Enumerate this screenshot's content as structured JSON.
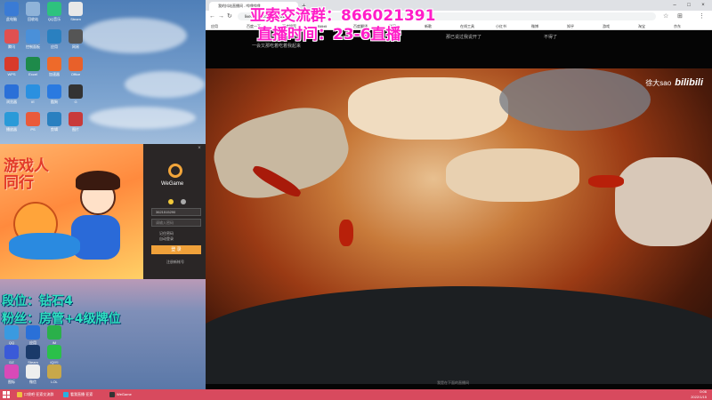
{
  "desktop": {
    "icons": [
      {
        "label": "此电脑",
        "color": "#3a7bd5"
      },
      {
        "label": "回收站",
        "color": "#8fb3d9"
      },
      {
        "label": "QQ音乐",
        "color": "#2ec27e"
      },
      {
        "label": "Steam",
        "color": "#e8e8e8"
      },
      {
        "label": "腾讯",
        "color": "#e05050"
      },
      {
        "label": "控制面板",
        "color": "#4a90d9"
      },
      {
        "label": "应用",
        "color": "#2a80c0"
      },
      {
        "label": "网易",
        "color": "#555"
      },
      {
        "label": "WPS",
        "color": "#d83a2a"
      },
      {
        "label": "Excel",
        "color": "#1e8a4a"
      },
      {
        "label": "加速器",
        "color": "#ee6a2a"
      },
      {
        "label": "Office",
        "color": "#e8602a"
      },
      {
        "label": "浏览器",
        "color": "#2a70d8"
      },
      {
        "label": "IE",
        "color": "#2a90e0"
      },
      {
        "label": "酷狗",
        "color": "#2a7ae0"
      },
      {
        "label": "G",
        "color": "#333"
      },
      {
        "label": "播放器",
        "color": "#2a9ad8"
      },
      {
        "label": "PS",
        "color": "#ea5a3a"
      },
      {
        "label": "剪辑",
        "color": "#2a80c0"
      },
      {
        "label": "图片",
        "color": "#c83a3a"
      }
    ],
    "overlay_line1": "段位：钻石4",
    "overlay_line2": "粉丝：房管+4级牌位",
    "bottom_icons": [
      {
        "label": "QQ",
        "color": "#3a9ae0"
      },
      {
        "label": "应用",
        "color": "#2a70d8"
      },
      {
        "label": "iM",
        "color": "#2ab04a"
      },
      {
        "label": "DZ",
        "color": "#3a5ad8"
      },
      {
        "label": "Steam",
        "color": "#1a3a6a"
      },
      {
        "label": "iQIYI",
        "color": "#2ac04a"
      },
      {
        "label": "图标",
        "color": "#d84ab8"
      },
      {
        "label": "微信",
        "color": "#eee"
      },
      {
        "label": "LOL",
        "color": "#c8a84a"
      }
    ]
  },
  "wegame": {
    "banner_title_line1": "游戏人",
    "banner_title_line2": "同行",
    "app_name": "WeGame",
    "account_value": "3621515290",
    "password_placeholder": "请输入密码",
    "remember_label": "记住密码",
    "auto_login_label": "自动登录",
    "login_button": "登 录",
    "register_link": "注册新帐号"
  },
  "browser": {
    "tab_title": "我的抖站直播间 - 哔哩哔哩",
    "new_tab_icon": "plus-icon",
    "url": "live.bilibili.com/866021391",
    "bookmarks": [
      "应用",
      "百度一下",
      "百度搜索",
      "Bilibili",
      "百度翻译",
      "学习",
      "新歌",
      "在线工具",
      "小红书",
      "微博",
      "知乎",
      "游戏",
      "淘宝",
      "京东"
    ],
    "lyrics": [
      "一会又那吃着吃着我起来",
      "那已说过我说开了",
      "不得了"
    ],
    "watermark_user": "徐大sao",
    "watermark_brand": "bilibili",
    "subtitle": "我是在下面的直播间",
    "stream_line1": "亚索交流群：866021391",
    "stream_line2": "直播时间：23-6直播"
  },
  "taskbar": {
    "items": [
      {
        "label": "口袋吧·亚索交流群",
        "color": "#f0c040"
      },
      {
        "label": "看我直播·亚索",
        "color": "#2ab0e0"
      },
      {
        "label": "WeGame",
        "color": "#333"
      }
    ],
    "tray_time": "0:06",
    "tray_date": "2022/1/15"
  }
}
